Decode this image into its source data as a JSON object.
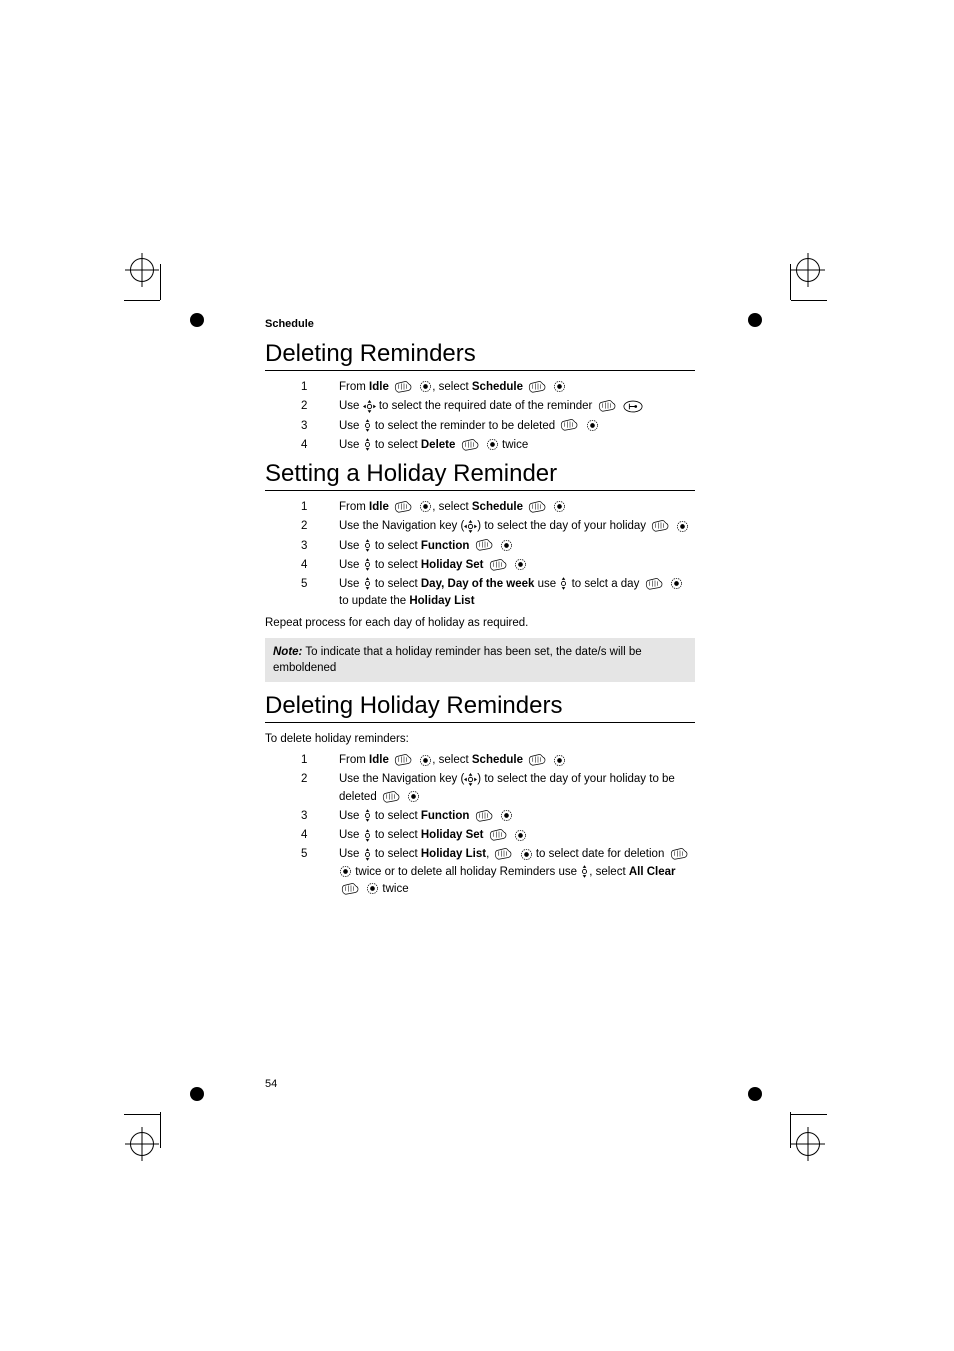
{
  "chapter": "Schedule",
  "page_number": "54",
  "sections": [
    {
      "title": "Deleting Reminders",
      "steps": [
        {
          "num": "1",
          "parts": [
            "From ",
            {
              "b": "Idle"
            },
            " ",
            {
              "icon": "hand"
            },
            " ",
            {
              "icon": "dot"
            },
            ", select ",
            {
              "b": "Schedule"
            },
            " ",
            {
              "icon": "hand"
            },
            " ",
            {
              "icon": "dot"
            }
          ]
        },
        {
          "num": "2",
          "parts": [
            "Use ",
            {
              "icon": "nav4"
            },
            " to select the required date of the reminder  ",
            {
              "icon": "hand"
            },
            " ",
            {
              "icon": "oval-left"
            }
          ]
        },
        {
          "num": "3",
          "parts": [
            "Use ",
            {
              "icon": "nav-ud"
            },
            " to select the reminder to be deleted ",
            {
              "icon": "hand"
            },
            " ",
            {
              "icon": "dot"
            }
          ]
        },
        {
          "num": "4",
          "parts": [
            "Use ",
            {
              "icon": "nav-ud"
            },
            " to select ",
            {
              "b": "Delete"
            },
            " ",
            {
              "icon": "hand"
            },
            " ",
            {
              "icon": "dot"
            },
            " twice"
          ]
        }
      ]
    },
    {
      "title": "Setting a Holiday Reminder",
      "steps": [
        {
          "num": "1",
          "parts": [
            "From ",
            {
              "b": "Idle"
            },
            " ",
            {
              "icon": "hand"
            },
            " ",
            {
              "icon": "dot"
            },
            ", select ",
            {
              "b": "Schedule"
            },
            " ",
            {
              "icon": "hand"
            },
            " ",
            {
              "icon": "dot"
            }
          ]
        },
        {
          "num": "2",
          "parts": [
            "Use the Navigation key (",
            {
              "icon": "nav4"
            },
            ") to select the day of your holiday ",
            {
              "icon": "hand"
            },
            " ",
            {
              "icon": "dot"
            }
          ]
        },
        {
          "num": "3",
          "parts": [
            "Use ",
            {
              "icon": "nav-ud"
            },
            " to select ",
            {
              "b": "Function"
            },
            "  ",
            {
              "icon": "hand"
            },
            " ",
            {
              "icon": "dot"
            }
          ]
        },
        {
          "num": "4",
          "parts": [
            "Use ",
            {
              "icon": "nav-ud"
            },
            " to select ",
            {
              "b": "Holiday Set"
            },
            " ",
            {
              "icon": "hand"
            },
            " ",
            {
              "icon": "dot"
            }
          ]
        },
        {
          "num": "5",
          "parts": [
            "Use ",
            {
              "icon": "nav-ud"
            },
            " to select ",
            {
              "b": "Day, Day of the week"
            },
            " use ",
            {
              "icon": "nav-ud"
            },
            " to selct a day  ",
            {
              "icon": "hand"
            },
            " ",
            {
              "icon": "dot"
            },
            "  to update the ",
            {
              "b": "Holiday List"
            }
          ]
        }
      ],
      "after_text": "Repeat process for each day of holiday as required.",
      "note": {
        "label": "Note:",
        "text": " To indicate that a holiday reminder has been set, the date/s will be emboldened"
      }
    },
    {
      "title": "Deleting Holiday Reminders",
      "before_text": "To delete holiday reminders:",
      "steps": [
        {
          "num": "1",
          "parts": [
            "From ",
            {
              "b": "Idle"
            },
            " ",
            {
              "icon": "hand"
            },
            " ",
            {
              "icon": "dot"
            },
            ", select ",
            {
              "b": "Schedule"
            },
            " ",
            {
              "icon": "hand"
            },
            " ",
            {
              "icon": "dot"
            }
          ]
        },
        {
          "num": "2",
          "parts": [
            "Use the Navigation key (",
            {
              "icon": "nav4"
            },
            ") to select the day of your holiday to be deleted  ",
            {
              "icon": "hand"
            },
            " ",
            {
              "icon": "dot"
            }
          ]
        },
        {
          "num": "3",
          "parts": [
            "Use ",
            {
              "icon": "nav-ud"
            },
            " to select ",
            {
              "b": "Function"
            },
            " ",
            {
              "icon": "hand"
            },
            " ",
            {
              "icon": "dot"
            }
          ]
        },
        {
          "num": "4",
          "parts": [
            "Use ",
            {
              "icon": "nav-ud"
            },
            " to select ",
            {
              "b": "Holiday Set"
            },
            "  ",
            {
              "icon": "hand"
            },
            " ",
            {
              "icon": "dot"
            }
          ]
        },
        {
          "num": "5",
          "parts": [
            "Use ",
            {
              "icon": "nav-ud"
            },
            " to select ",
            {
              "b": "Holiday List"
            },
            ", ",
            {
              "icon": "hand"
            },
            " ",
            {
              "icon": "dot"
            },
            " to select date for deletion ",
            {
              "icon": "hand"
            },
            " ",
            {
              "icon": "dot"
            },
            " twice or to delete all holiday Reminders use ",
            {
              "icon": "nav-ud"
            },
            ", select ",
            {
              "b": "All Clear"
            },
            " ",
            {
              "icon": "hand"
            },
            " ",
            {
              "icon": "dot"
            },
            " twice"
          ]
        }
      ]
    }
  ]
}
